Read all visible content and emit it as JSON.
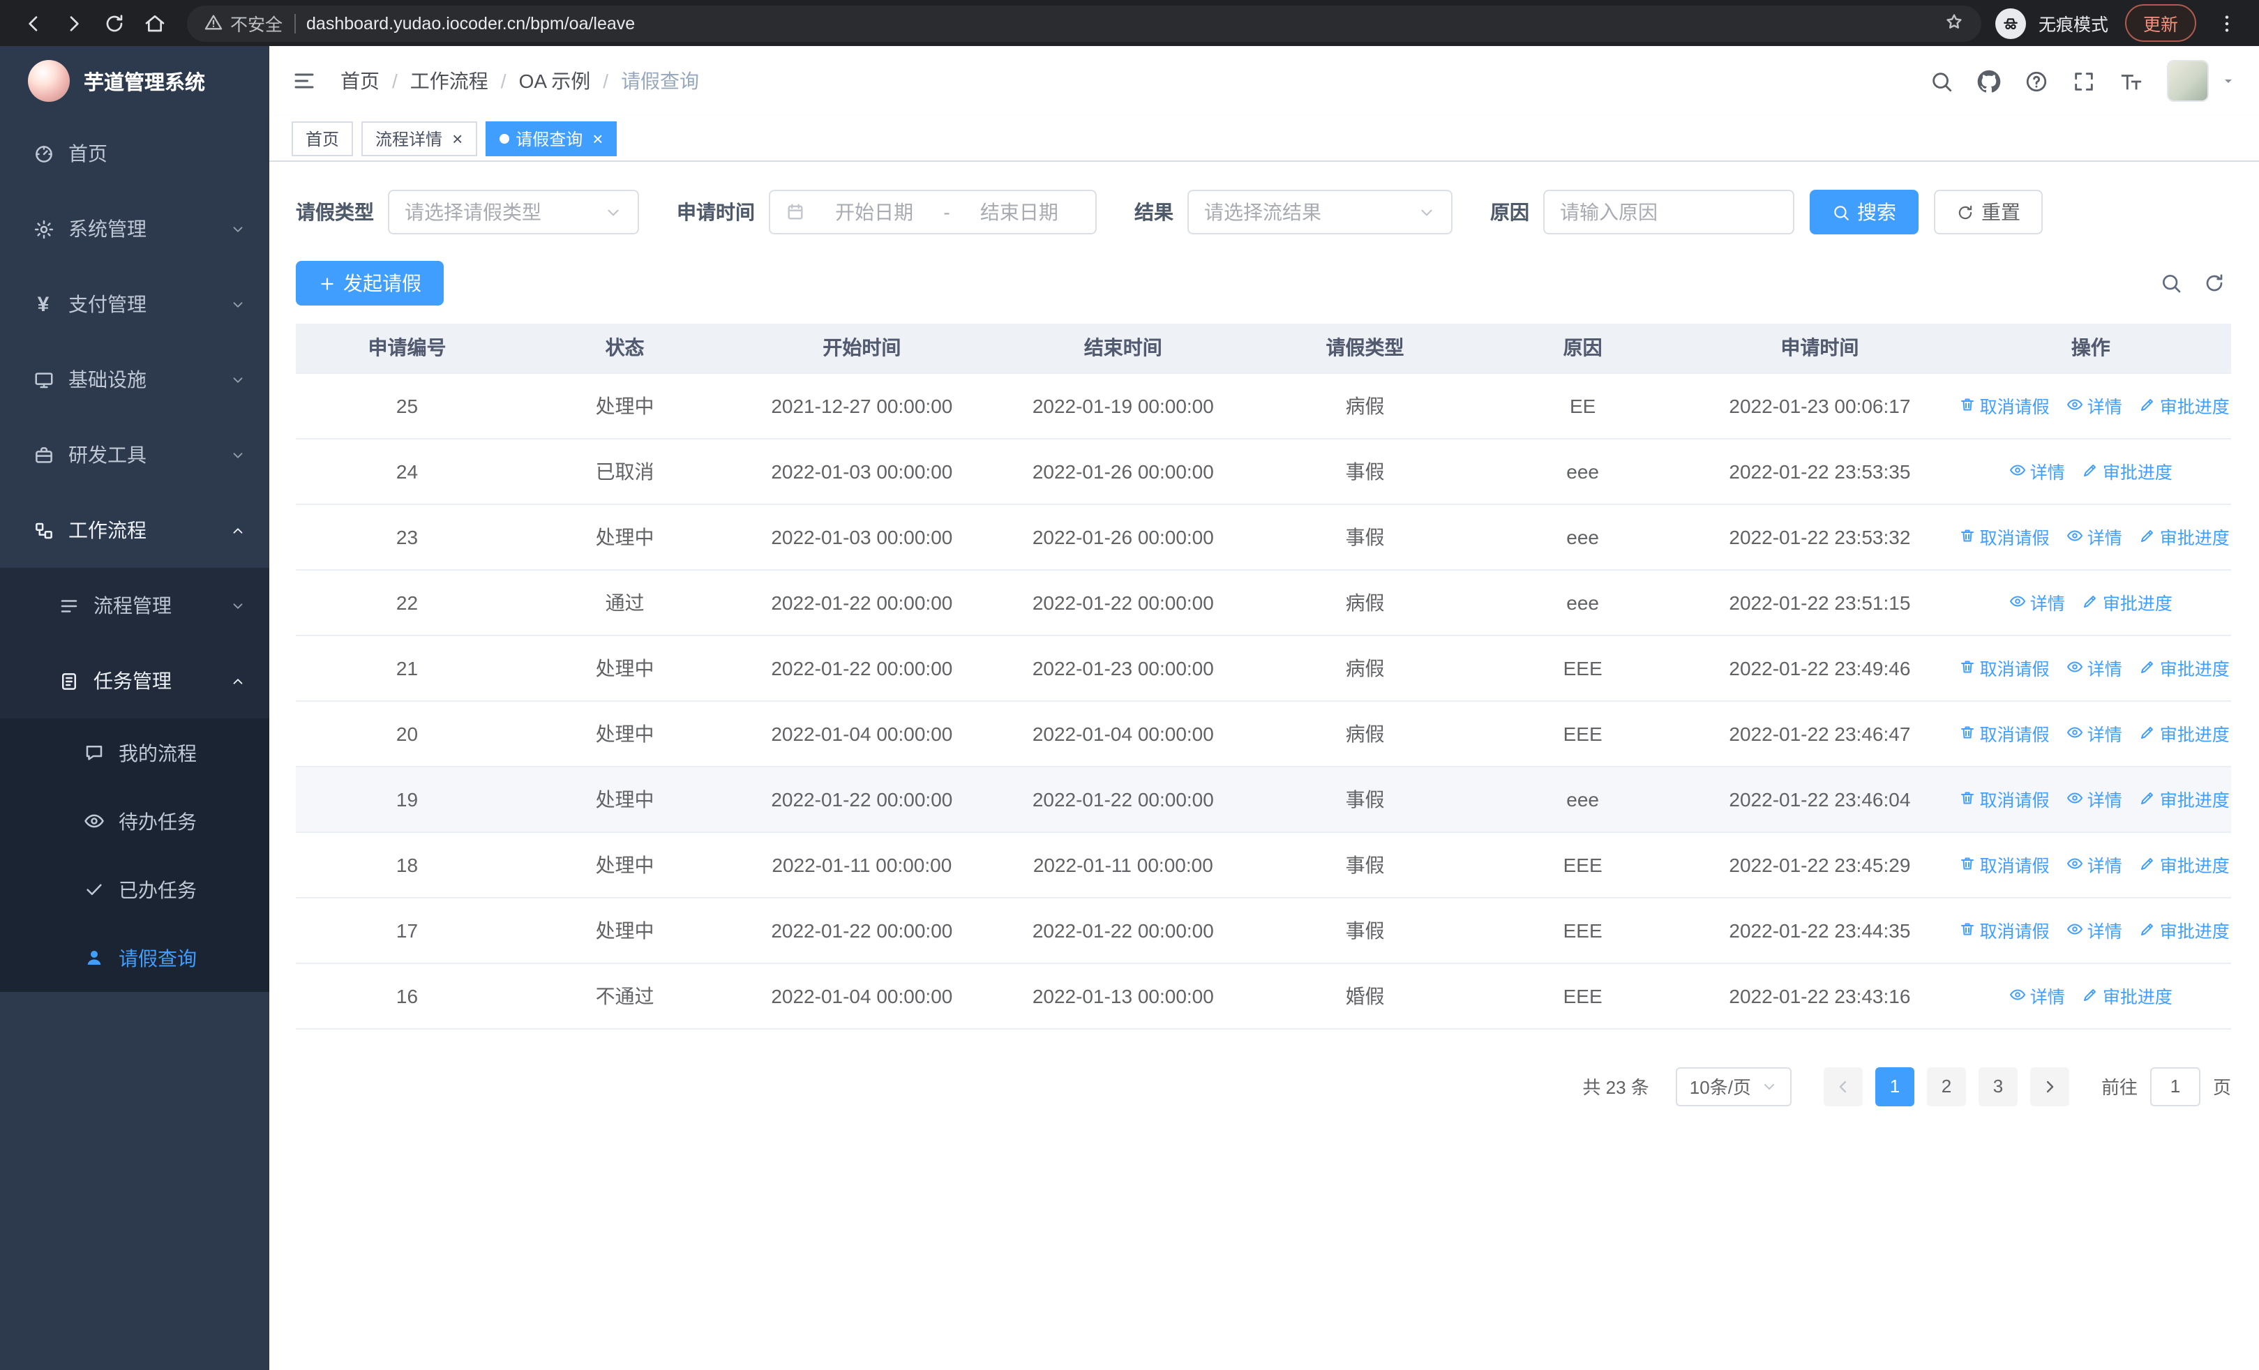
{
  "browser": {
    "security_label": "不安全",
    "url": "dashboard.yudao.iocoder.cn/bpm/oa/leave",
    "incognito_label": "无痕模式",
    "update_label": "更新"
  },
  "sidebar": {
    "logo_title": "芋道管理系统",
    "items": [
      {
        "label": "首页",
        "icon": "dashboard-icon",
        "level": 1
      },
      {
        "label": "系统管理",
        "icon": "gear-icon",
        "level": 1,
        "chevron": "down"
      },
      {
        "label": "支付管理",
        "icon": "yen-icon",
        "level": 1,
        "chevron": "down"
      },
      {
        "label": "基础设施",
        "icon": "monitor-icon",
        "level": 1,
        "chevron": "down"
      },
      {
        "label": "研发工具",
        "icon": "briefcase-icon",
        "level": 1,
        "chevron": "down"
      },
      {
        "label": "工作流程",
        "icon": "workflow-icon",
        "level": 1,
        "chevron": "up",
        "parent_open": true
      },
      {
        "label": "流程管理",
        "icon": "process-icon",
        "level": 2,
        "chevron": "down"
      },
      {
        "label": "任务管理",
        "icon": "task-icon",
        "level": 2,
        "chevron": "up",
        "parent_open": true
      },
      {
        "label": "我的流程",
        "icon": "chat-icon",
        "level": 3
      },
      {
        "label": "待办任务",
        "icon": "eye-icon",
        "level": 3
      },
      {
        "label": "已办任务",
        "icon": "check-icon",
        "level": 3
      },
      {
        "label": "请假查询",
        "icon": "user-icon",
        "level": 3,
        "active": true
      }
    ]
  },
  "header": {
    "breadcrumb": [
      "首页",
      "工作流程",
      "OA 示例",
      "请假查询"
    ]
  },
  "tabs": [
    {
      "label": "首页",
      "closable": false,
      "active": false
    },
    {
      "label": "流程详情",
      "closable": true,
      "active": false
    },
    {
      "label": "请假查询",
      "closable": true,
      "active": true
    }
  ],
  "filters": {
    "leave_type_label": "请假类型",
    "leave_type_placeholder": "请选择请假类型",
    "apply_time_label": "申请时间",
    "start_date_placeholder": "开始日期",
    "range_separator": "-",
    "end_date_placeholder": "结束日期",
    "result_label": "结果",
    "result_placeholder": "请选择流结果",
    "reason_label": "原因",
    "reason_placeholder": "请输入原因",
    "search_button": "搜索",
    "reset_button": "重置"
  },
  "toolbar": {
    "create_button": "发起请假"
  },
  "table": {
    "columns": [
      "申请编号",
      "状态",
      "开始时间",
      "结束时间",
      "请假类型",
      "原因",
      "申请时间",
      "操作"
    ],
    "action_labels": {
      "cancel": "取消请假",
      "detail": "详情",
      "progress": "审批进度"
    },
    "rows": [
      {
        "id": "25",
        "status": "处理中",
        "start_time": "2021-12-27 00:00:00",
        "end_time": "2022-01-19 00:00:00",
        "leave_type": "病假",
        "reason": "EE",
        "apply_time": "2022-01-23 00:06:17",
        "actions": [
          "cancel",
          "detail",
          "progress"
        ]
      },
      {
        "id": "24",
        "status": "已取消",
        "start_time": "2022-01-03 00:00:00",
        "end_time": "2022-01-26 00:00:00",
        "leave_type": "事假",
        "reason": "eee",
        "apply_time": "2022-01-22 23:53:35",
        "actions": [
          "detail",
          "progress"
        ]
      },
      {
        "id": "23",
        "status": "处理中",
        "start_time": "2022-01-03 00:00:00",
        "end_time": "2022-01-26 00:00:00",
        "leave_type": "事假",
        "reason": "eee",
        "apply_time": "2022-01-22 23:53:32",
        "actions": [
          "cancel",
          "detail",
          "progress"
        ]
      },
      {
        "id": "22",
        "status": "通过",
        "start_time": "2022-01-22 00:00:00",
        "end_time": "2022-01-22 00:00:00",
        "leave_type": "病假",
        "reason": "eee",
        "apply_time": "2022-01-22 23:51:15",
        "actions": [
          "detail",
          "progress"
        ]
      },
      {
        "id": "21",
        "status": "处理中",
        "start_time": "2022-01-22 00:00:00",
        "end_time": "2022-01-23 00:00:00",
        "leave_type": "病假",
        "reason": "EEE",
        "apply_time": "2022-01-22 23:49:46",
        "actions": [
          "cancel",
          "detail",
          "progress"
        ]
      },
      {
        "id": "20",
        "status": "处理中",
        "start_time": "2022-01-04 00:00:00",
        "end_time": "2022-01-04 00:00:00",
        "leave_type": "病假",
        "reason": "EEE",
        "apply_time": "2022-01-22 23:46:47",
        "actions": [
          "cancel",
          "detail",
          "progress"
        ]
      },
      {
        "id": "19",
        "status": "处理中",
        "start_time": "2022-01-22 00:00:00",
        "end_time": "2022-01-22 00:00:00",
        "leave_type": "事假",
        "reason": "eee",
        "apply_time": "2022-01-22 23:46:04",
        "actions": [
          "cancel",
          "detail",
          "progress"
        ],
        "highlighted": true
      },
      {
        "id": "18",
        "status": "处理中",
        "start_time": "2022-01-11 00:00:00",
        "end_time": "2022-01-11 00:00:00",
        "leave_type": "事假",
        "reason": "EEE",
        "apply_time": "2022-01-22 23:45:29",
        "actions": [
          "cancel",
          "detail",
          "progress"
        ]
      },
      {
        "id": "17",
        "status": "处理中",
        "start_time": "2022-01-22 00:00:00",
        "end_time": "2022-01-22 00:00:00",
        "leave_type": "事假",
        "reason": "EEE",
        "apply_time": "2022-01-22 23:44:35",
        "actions": [
          "cancel",
          "detail",
          "progress"
        ]
      },
      {
        "id": "16",
        "status": "不通过",
        "start_time": "2022-01-04 00:00:00",
        "end_time": "2022-01-13 00:00:00",
        "leave_type": "婚假",
        "reason": "EEE",
        "apply_time": "2022-01-22 23:43:16",
        "actions": [
          "detail",
          "progress"
        ]
      }
    ]
  },
  "pagination": {
    "total_text": "共 23 条",
    "page_size_label": "10条/页",
    "pages": [
      "1",
      "2",
      "3"
    ],
    "active_page": "1",
    "goto_label": "前往",
    "goto_value": "1",
    "goto_suffix": "页"
  }
}
